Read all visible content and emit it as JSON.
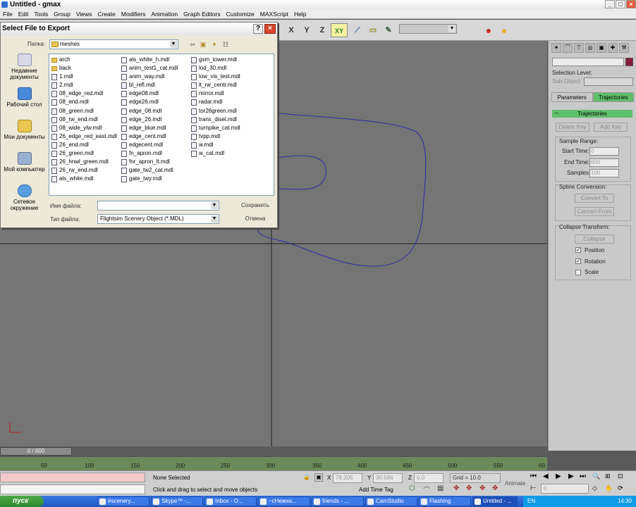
{
  "window": {
    "title": "Untitled - gmax",
    "minimize": "_",
    "restore": "□",
    "close": "×"
  },
  "menu": [
    "File",
    "Edit",
    "Tools",
    "Group",
    "Views",
    "Create",
    "Modifiers",
    "Animation",
    "Graph Editors",
    "Customize",
    "MAXScript",
    "Help"
  ],
  "toolbar": {
    "axis_x": "X",
    "axis_y": "Y",
    "axis_z": "Z",
    "axis_xy": "XY",
    "icons": [
      "snap-icon",
      "select-filter-icon",
      "render-icon",
      "material-icon"
    ]
  },
  "dialog": {
    "title": "Select File to Export",
    "help": "?",
    "close": "×",
    "lookin_label": "Папка:",
    "lookin_value": "meshes",
    "places": [
      "Недавние документы",
      "Рабочий стол",
      "Мои документы",
      "Мой компьютер",
      "Сетевое окружение"
    ],
    "folders": [
      "arch",
      "back"
    ],
    "files_col1": [
      "1.mdl",
      "2.mdl",
      "08_edge_red.mdl",
      "08_end.mdl",
      "08_green.mdl",
      "08_rw_end.mdl",
      "08_wide_ylw.mdl",
      "26_edge_red_east.mdl",
      "26_end.mdl",
      "26_green.mdl",
      "26_hnwl_green.mdl",
      "26_rw_end.mdl",
      "als_white.mdl"
    ],
    "files_col2": [
      "als_white_h.mdl",
      "anim_test1_cat.mdl",
      "anim_way.mdl",
      "bl_refl.mdl",
      "edge08.mdl",
      "edge26.mdl",
      "edge_08.mdl",
      "edge_26.mdl",
      "edge_blue.mdl",
      "edge_cent.mdl",
      "edgecent.mdl",
      "fn_apron.mdl",
      "fnr_apron_lt.mdl",
      "gate_tw2_cat.mdl",
      "gate_twy.mdl"
    ],
    "files_col3": [
      "gsm_tower.mdl",
      "lod_30.mdl",
      "low_vis_test.mdl",
      "lt_rw_centr.mdl",
      "mirror.mdl",
      "radar.mdl",
      "tor26green.mdl",
      "trans_disel.mdl",
      "turnpike_cat.mdl",
      "tvpp.mdl",
      "w.mdl",
      "w_cat.mdl"
    ],
    "filename_label": "Имя файла:",
    "filename_value": "",
    "filetype_label": "Тип файла:",
    "filetype_value": "Flightsim Scenery Object (*.MDL)",
    "save_button": "Сохранить",
    "cancel_button": "Отмена"
  },
  "right_panel": {
    "selection_level_label": "Selection Level:",
    "selection_level_value": "Sub-Object",
    "tab_parameters": "Parameters",
    "tab_trajectories": "Trajectories",
    "rollout_title": "Trajectories",
    "delete_key": "Delete Key",
    "add_key": "Add Key",
    "sample_range": "Sample Range:",
    "start_time_label": "Start Time:",
    "start_time_value": "0",
    "end_time_label": "End Time:",
    "end_time_value": "600",
    "samples_label": "Samples:",
    "samples_value": "100",
    "spline_conversion": "Spline Conversion:",
    "convert_to": "Convert To",
    "convert_from": "Convert From",
    "collapse_transform": "Collapse Transform:",
    "collapse": "Collapse",
    "position": "Position",
    "rotation": "Rotation",
    "scale": "Scale",
    "position_checked": true,
    "rotation_checked": true,
    "scale_checked": false
  },
  "timeline": {
    "slider_label": "0 / 600",
    "ticks": [
      "50",
      "100",
      "150",
      "200",
      "250",
      "300",
      "350",
      "400",
      "450",
      "500",
      "550",
      "60"
    ]
  },
  "status": {
    "selection": "None Selected",
    "prompt": "Click and drag to select and move objects",
    "x_label": "X",
    "x_value": "78.205",
    "y_label": "Y",
    "y_value": "30.586",
    "z_label": "Z",
    "z_value": "0.0",
    "grid": "Grid = 10.0",
    "add_time_tag": "Add Time Tag",
    "animate": "Animate",
    "frame_value": "0"
  },
  "taskbar": {
    "start": "пуск",
    "tasks": [
      "#scenery...",
      "Skype™ -...",
      "Inbox - O...",
      "~cНежна...",
      "friends - ...",
      "CamStudio",
      "Flashing",
      "Untitled - ..."
    ],
    "lang": "EN",
    "clock": "14:30"
  },
  "colors": {
    "viewport_bg": "#757575",
    "trajectory": "#2a2aa8",
    "accent_green": "#5fbf6a",
    "taskbar": "#2a63d4"
  }
}
